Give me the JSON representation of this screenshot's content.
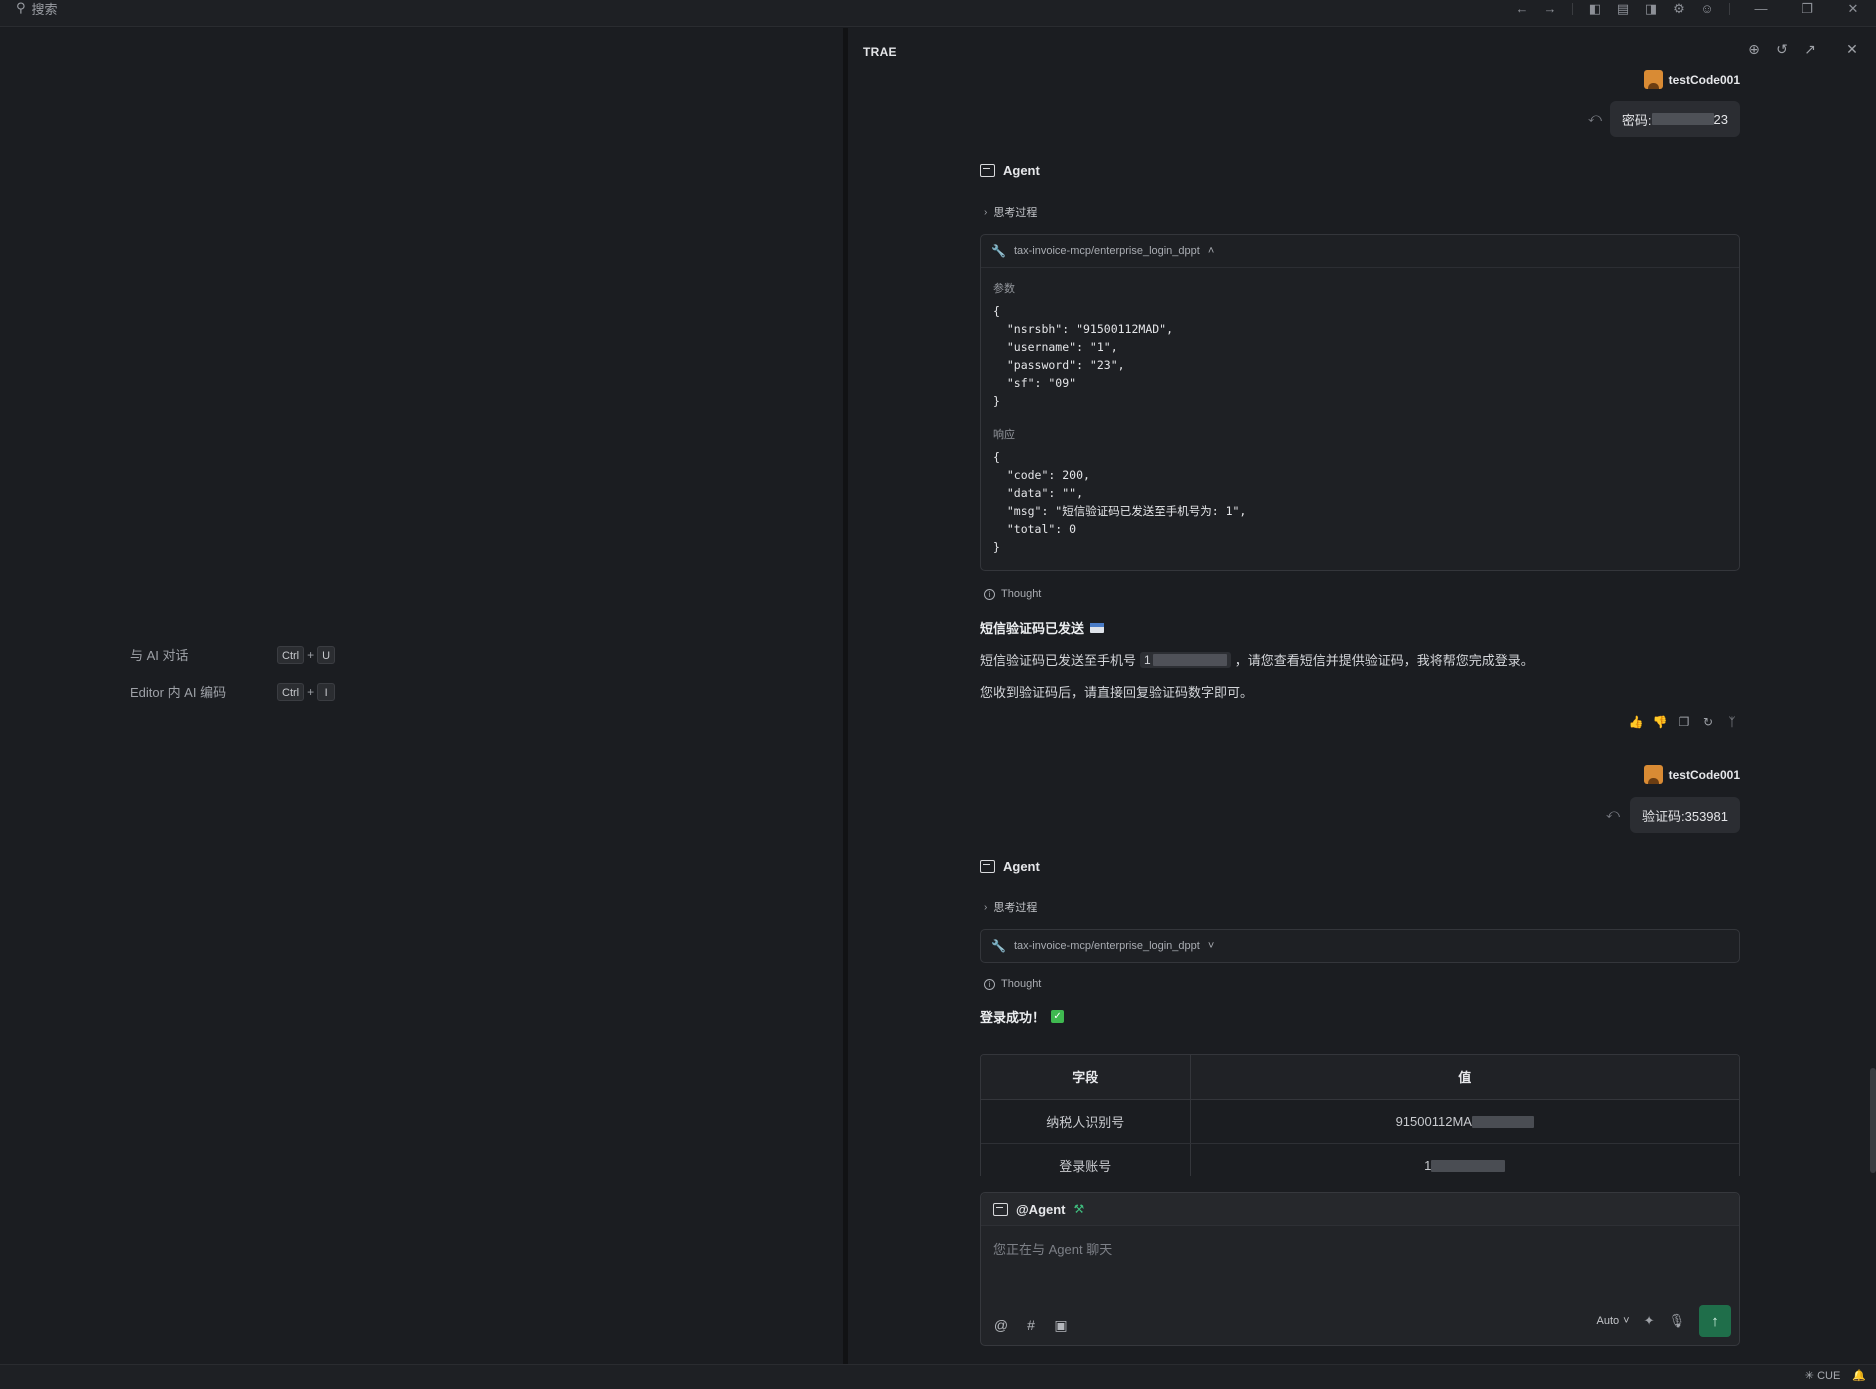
{
  "topbar": {
    "search_label": "搜索",
    "icons": [
      "arrow-left-icon",
      "arrow-right-icon",
      "layout-left-icon",
      "layout-bottom-icon",
      "layout-right-icon",
      "settings-icon",
      "account-icon",
      "minimize-icon",
      "restore-icon",
      "close-icon"
    ]
  },
  "left": {
    "shortcuts": [
      {
        "label": "与 AI 对话",
        "key1": "Ctrl",
        "plus": "+",
        "key2": "U"
      },
      {
        "label": "Editor 内 AI 编码",
        "key1": "Ctrl",
        "plus": "+",
        "key2": "I"
      }
    ]
  },
  "panel": {
    "title": "TRAE"
  },
  "messages": {
    "user1": {
      "name": "testCode001",
      "text_prefix": "密码:",
      "text_suffix": "23"
    },
    "agent1": {
      "name": "Agent",
      "think_label": "思考过程",
      "tool_name": "tax-invoice-mcp/enterprise_login_dppt",
      "params_label": "参数",
      "params_code": "{\n  \"nsrsbh\": \"91500112MAD\",\n  \"username\": \"1\",\n  \"password\": \"23\",\n  \"sf\": \"09\"\n}",
      "response_label": "响应",
      "response_code": "{\n  \"code\": 200,\n  \"data\": \"\",\n  \"msg\": \"短信验证码已发送至手机号为: 1\",\n  \"total\": 0\n}",
      "thought_label": "Thought",
      "heading": "短信验证码已发送",
      "line1_prefix": "短信验证码已发送至手机号",
      "line1_masked": "1",
      "line1_suffix": "，请您查看短信并提供验证码，我将帮您完成登录。",
      "line2": "您收到验证码后，请直接回复验证码数字即可。"
    },
    "user2": {
      "name": "testCode001",
      "text": "验证码:353981"
    },
    "agent2": {
      "name": "Agent",
      "think_label": "思考过程",
      "tool_name": "tax-invoice-mcp/enterprise_login_dppt",
      "thought_label": "Thought",
      "heading": "登录成功！",
      "table": {
        "headers": [
          "字段",
          "值"
        ],
        "rows": [
          [
            "纳税人识别号",
            "91500112MA"
          ],
          [
            "登录账号",
            "1"
          ]
        ]
      }
    }
  },
  "input": {
    "mention": "@Agent",
    "placeholder": "您正在与 Agent 聊天",
    "mode": "Auto"
  },
  "status": {
    "right_label": "CUE"
  },
  "colors": {
    "accent_green": "#1f6e4a",
    "avatar_orange": "#d98b34",
    "tool_blue": "#5b8ff0"
  }
}
